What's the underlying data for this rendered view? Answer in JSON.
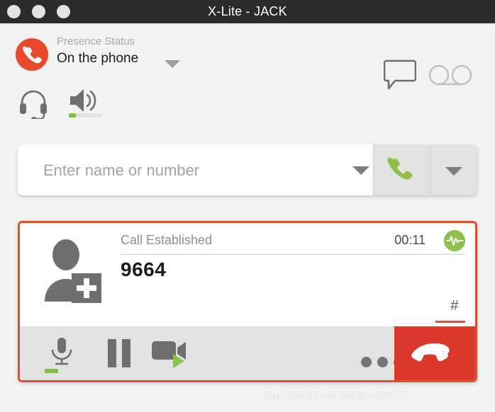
{
  "window": {
    "title": "X-Lite - JACK",
    "controls": [
      "close-button",
      "minimize-button",
      "maximize-button"
    ]
  },
  "presence": {
    "label": "Presence Status",
    "value": "On the phone",
    "avatar_icon": "phone-handset-icon",
    "caret_icon": "chevron-down-icon",
    "avatar_color": "#e8492a"
  },
  "header_actions": {
    "chat_icon": "chat-bubble-icon",
    "voicemail_icon": "voicemail-icon"
  },
  "audio": {
    "headset_icon": "headset-icon",
    "speaker_icon": "speaker-volume-icon",
    "speaker_level_percent": 22,
    "slider_percent": 32,
    "slider_fill_color": "#e0502c",
    "slider_track_color": "#bcbcbc",
    "level_color": "#84c046"
  },
  "dial": {
    "placeholder": "Enter name or number",
    "value": "",
    "history_caret_icon": "chevron-down-icon",
    "call_icon": "phone-call-icon",
    "call_icon_color": "#8cc04a",
    "options_caret_icon": "chevron-down-icon"
  },
  "call": {
    "status": "Call Established",
    "timer": "00:11",
    "number": "9664",
    "dtmf": "#",
    "avatar_icon": "add-contact-icon",
    "quality_icon": "call-quality-waveform-icon",
    "quality_color": "#8cc04a",
    "panel_border_color": "#e0502c"
  },
  "call_toolbar": {
    "mute_icon": "microphone-icon",
    "mic_level_percent": 40,
    "hold_icon": "pause-icon",
    "video_icon": "video-camera-icon",
    "more_icon": "more-dots-icon",
    "hangup_icon": "end-call-icon",
    "hangup_color": "#d9382b"
  },
  "watermark": {
    "text": "http://blog.csdn.net/guoer9973"
  }
}
